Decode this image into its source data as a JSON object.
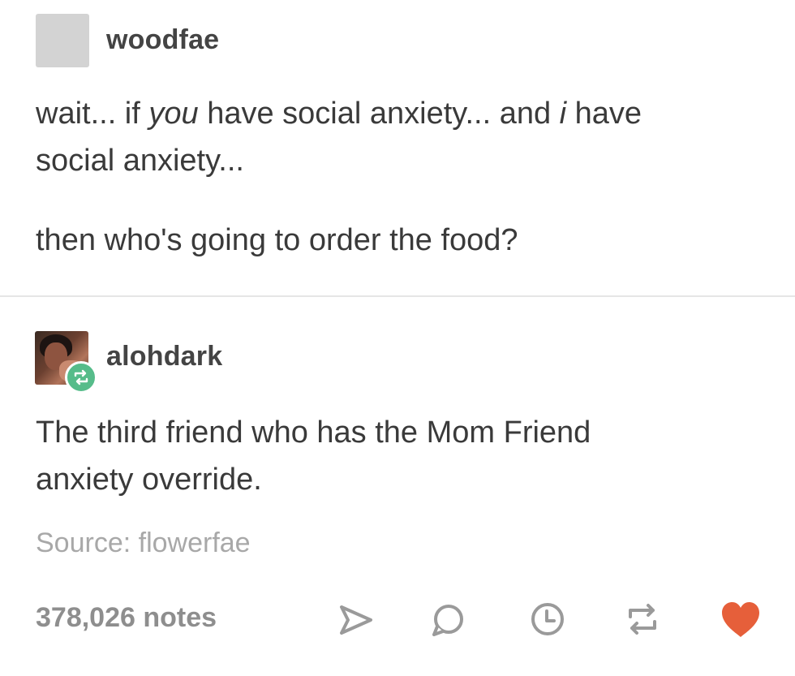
{
  "original_post": {
    "username": "woodfae",
    "line1_part1": "wait... if ",
    "line1_em1": "you",
    "line1_part2": " have social anxiety... and ",
    "line1_em2": "i",
    "line1_part3": " have",
    "line2": "social anxiety...",
    "line3": "then who's going to order the food?"
  },
  "reblog": {
    "username": "alohdark",
    "line1": "The third friend who has the Mom Friend",
    "line2": "anxiety override."
  },
  "source": "Source: flowerfae",
  "footer": {
    "notes": "378,026 notes",
    "actions": [
      "share-icon",
      "reply-icon",
      "clock-icon",
      "reblog-icon",
      "like-icon"
    ],
    "accent_colors": {
      "reblog_badge": "#56bc8a",
      "like": "#e65f3a",
      "icon_gray": "#9a9a9a"
    }
  }
}
